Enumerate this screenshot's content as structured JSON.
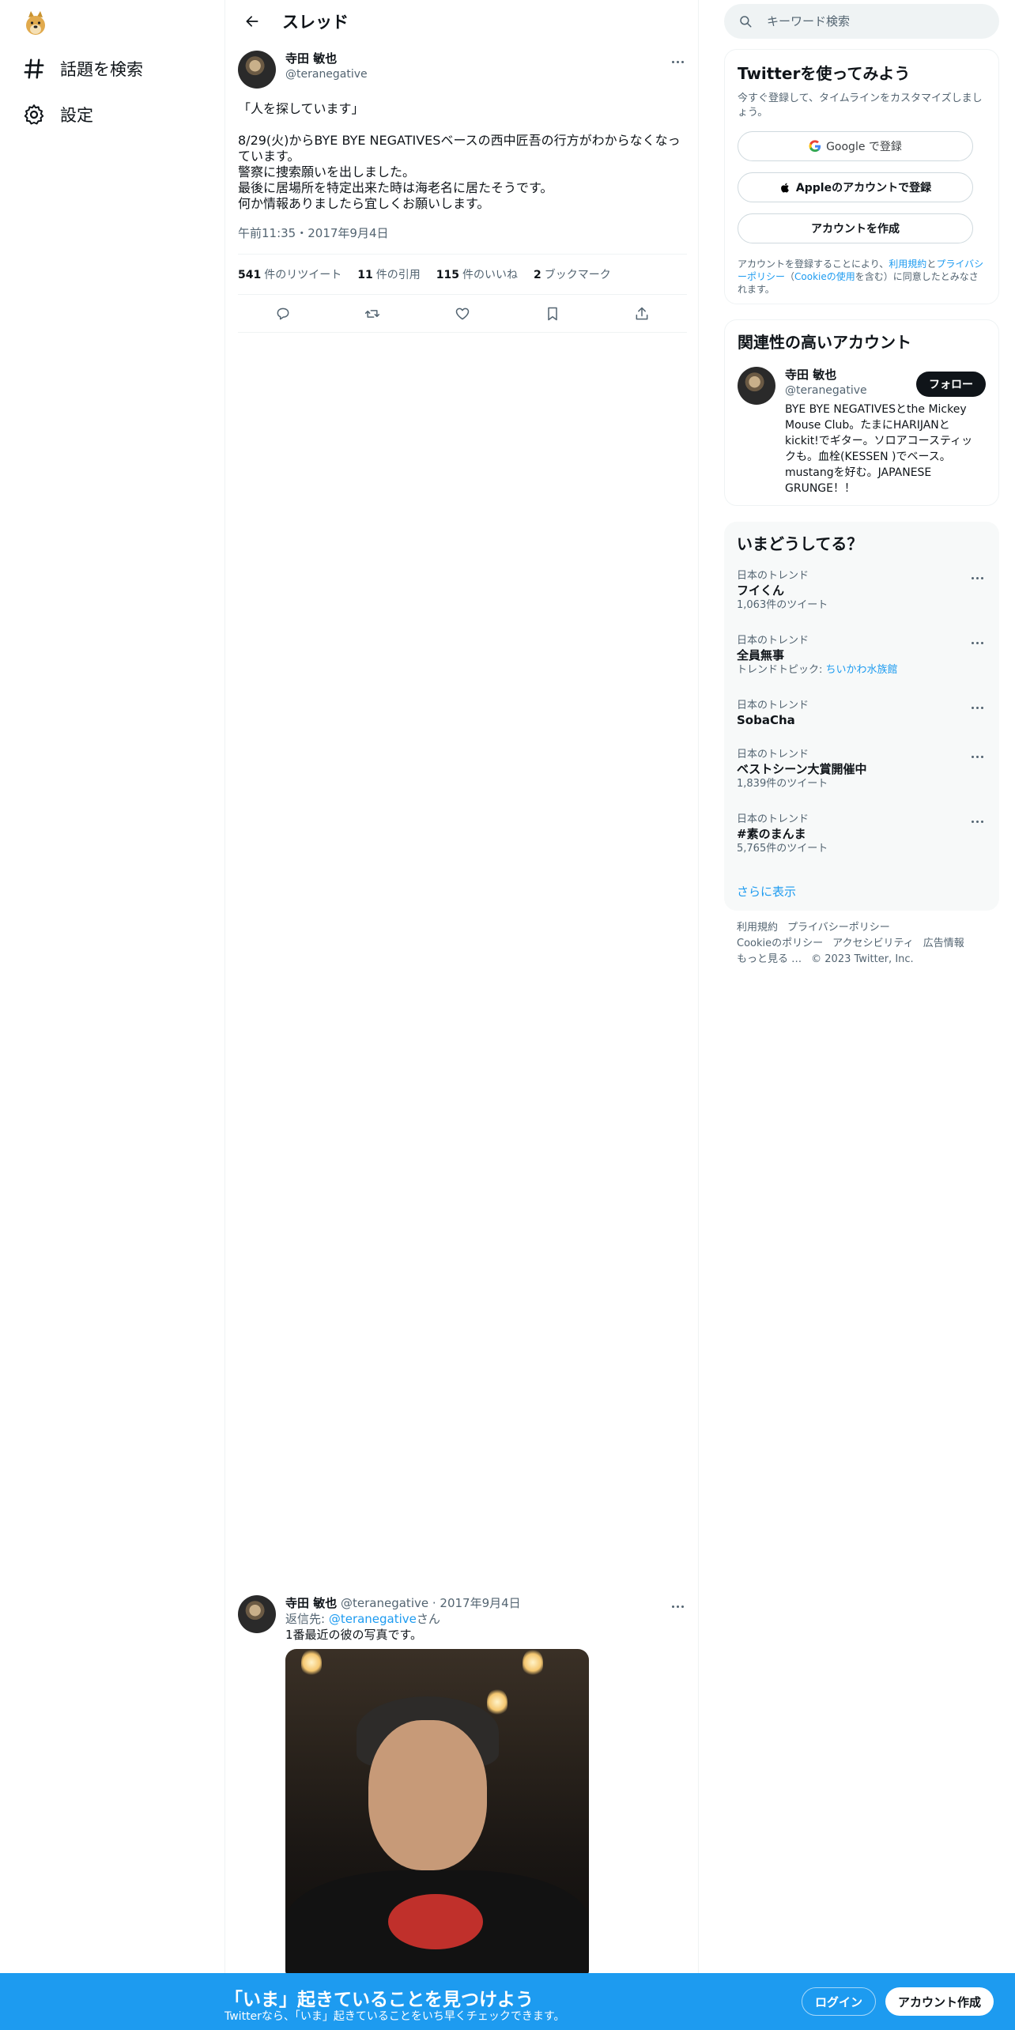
{
  "nav": {
    "items": [
      {
        "label": "話題を検索",
        "icon": "hashtag-icon"
      },
      {
        "label": "設定",
        "icon": "gear-icon"
      }
    ]
  },
  "header": {
    "title": "スレッド"
  },
  "tweet": {
    "name": "寺田 敏也",
    "handle": "@teranegative",
    "body": "「人を探しています」\n\n8/29(火)からBYE BYE NEGATIVESベースの西中匠吾の行方がわからなくなっています。\n警察に捜索願いを出しました。\n最後に居場所を特定出来た時は海老名に居たそうです。\n何か情報ありましたら宜しくお願いします。",
    "time": "午前11:35・2017年9月4日",
    "stats": [
      {
        "count": "541",
        "label": "件のリツイート"
      },
      {
        "count": "11",
        "label": "件の引用"
      },
      {
        "count": "115",
        "label": "件のいいね"
      },
      {
        "count": "2",
        "label": "ブックマーク"
      }
    ]
  },
  "reply": {
    "name": "寺田 敏也",
    "handle": "@teranegative",
    "date": "2017年9月4日",
    "reply_to_prefix": "返信先: ",
    "reply_to_handle": "@teranegative",
    "reply_to_suffix": "さん",
    "text": "1番最近の彼の写真です。"
  },
  "search": {
    "placeholder": "キーワード検索"
  },
  "signup": {
    "title": "Twitterを使ってみよう",
    "subtitle": "今すぐ登録して、タイムラインをカスタマイズしましょう。",
    "google_label": "Google で登録",
    "apple_label": "Appleのアカウントで登録",
    "create_label": "アカウントを作成",
    "legal_prefix": "アカウントを登録することにより、",
    "legal_terms": "利用規約",
    "legal_and": "と",
    "legal_privacy": "プライバシーポリシー",
    "legal_paren_open": "（",
    "legal_cookie": "Cookieの使用",
    "legal_suffix": "を含む）に同意したとみなされます。"
  },
  "related": {
    "title": "関連性の高いアカウント",
    "name": "寺田 敏也",
    "handle": "@teranegative",
    "follow_label": "フォロー",
    "bio": "BYE BYE NEGATIVESとthe Mickey Mouse Club。たまにHARIJANとkickit!でギター。ソロアコースティックも。血栓(KESSEN )でベース。mustangを好む。JAPANESE GRUNGE！！"
  },
  "trends": {
    "title": "いまどうしてる？",
    "items": [
      {
        "meta": "日本のトレンド",
        "name": "フイくん",
        "sub": "1,063件のツイート"
      },
      {
        "meta": "日本のトレンド",
        "name": "全員無事",
        "sub_prefix": "トレンドトピック: ",
        "sub_link": "ちいかわ水族館"
      },
      {
        "meta": "日本のトレンド",
        "name": "SobaCha",
        "sub": ""
      },
      {
        "meta": "日本のトレンド",
        "name": "ベストシーン大賞開催中",
        "sub": "1,839件のツイート"
      },
      {
        "meta": "日本のトレンド",
        "name": "#素のまんま",
        "sub": "5,765件のツイート"
      }
    ],
    "show_more": "さらに表示"
  },
  "footer": {
    "links": [
      "利用規約",
      "プライバシーポリシー",
      "Cookieのポリシー",
      "アクセシビリティ",
      "広告情報",
      "もっと見る …"
    ],
    "copyright": "© 2023 Twitter, Inc."
  },
  "banner": {
    "title": "「いま」起きていることを見つけよう",
    "subtitle": "Twitterなら、「いま」起きていることをいち早くチェックできます。",
    "login_label": "ログイン",
    "create_label": "アカウント作成"
  },
  "colors": {
    "accent": "#1d9bf0",
    "text": "#0f1419",
    "muted": "#536471"
  }
}
